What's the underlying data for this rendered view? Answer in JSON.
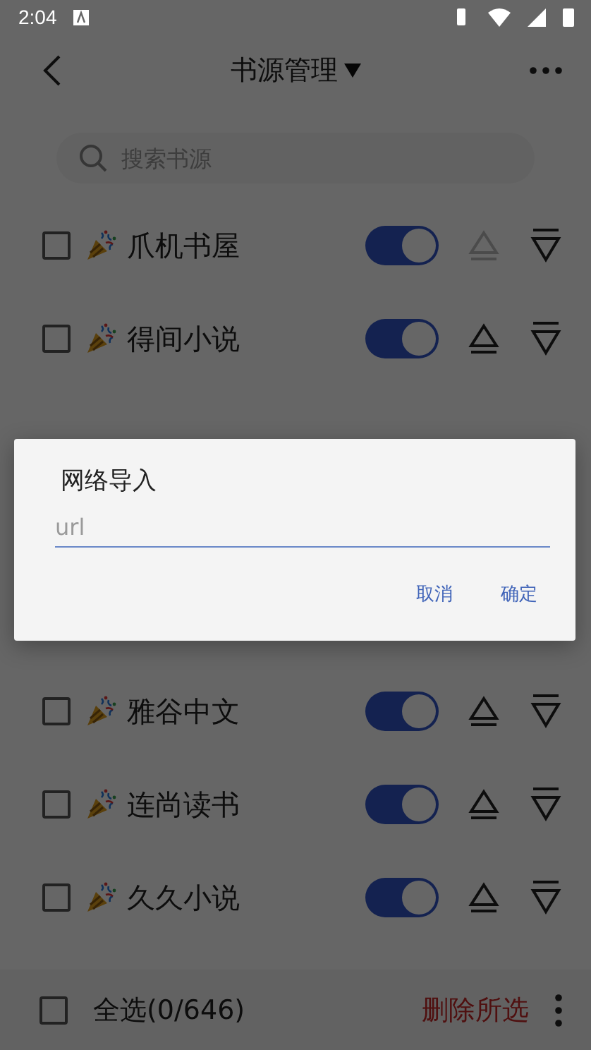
{
  "status_bar": {
    "time": "2:04"
  },
  "toolbar": {
    "title": "书源管理"
  },
  "search": {
    "placeholder": "搜索书源"
  },
  "sources": [
    {
      "name": "爪机书屋",
      "checked": false,
      "enabled": true,
      "can_move_up": false
    },
    {
      "name": "得间小说",
      "checked": false,
      "enabled": true,
      "can_move_up": true
    }
  ],
  "sources_below_dialog": [
    {
      "name": "雅谷中文",
      "checked": false,
      "enabled": true,
      "can_move_up": true
    },
    {
      "name": "连尚读书",
      "checked": false,
      "enabled": true,
      "can_move_up": true
    },
    {
      "name": "久久小说",
      "checked": false,
      "enabled": true,
      "can_move_up": true
    }
  ],
  "bottom_bar": {
    "select_all": {
      "label": "全选(0/646)",
      "checked": false
    },
    "delete_label": "删除所选"
  },
  "dialog": {
    "title": "网络导入",
    "input": {
      "placeholder": "url"
    },
    "buttons": [
      "取消",
      "确定"
    ]
  }
}
